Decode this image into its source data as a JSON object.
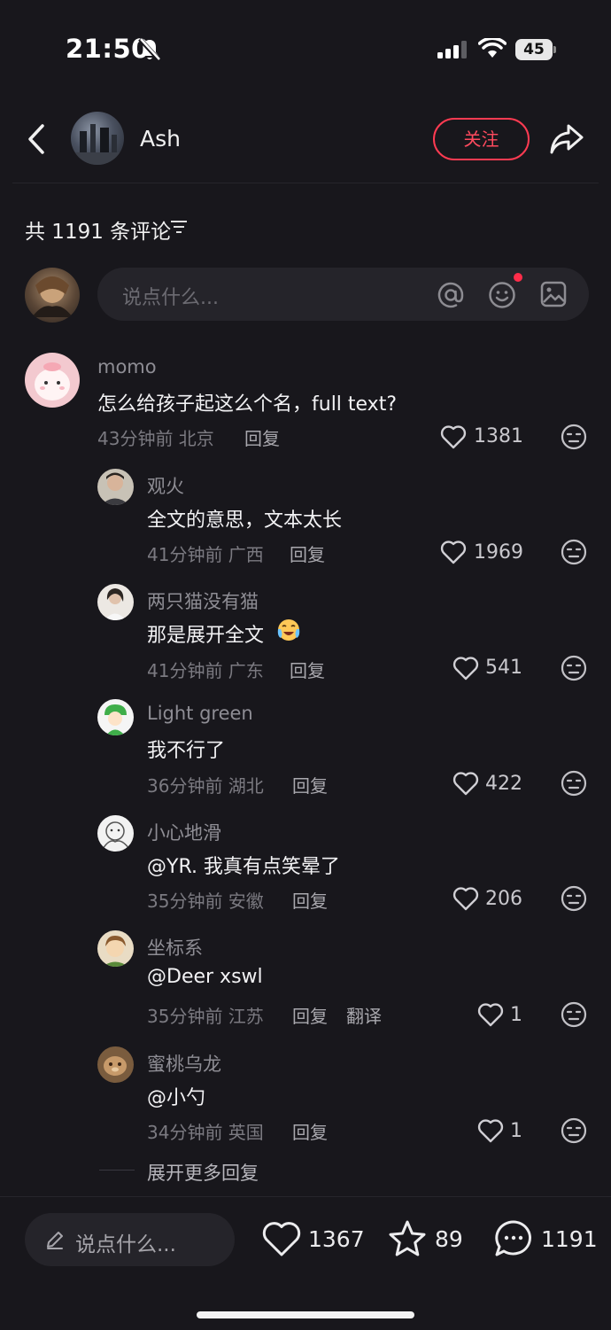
{
  "status_bar": {
    "time": "21:50",
    "battery": "45"
  },
  "header": {
    "author": "Ash",
    "follow_label": "关注"
  },
  "comments_header": {
    "count_label": "共 1191 条评论"
  },
  "input": {
    "placeholder": "说点什么..."
  },
  "comments": [
    {
      "name": "momo",
      "text": "怎么给孩子起这么个名，full text?",
      "time_loc": "43分钟前 北京",
      "reply": "回复",
      "likes": "1381"
    },
    {
      "name": "观火",
      "text": "全文的意思，文本太长",
      "time_loc": "41分钟前 广西",
      "reply": "回复",
      "likes": "1969"
    },
    {
      "name": "两只猫没有猫",
      "text": "那是展开全文",
      "time_loc": "41分钟前 广东",
      "reply": "回复",
      "likes": "541"
    },
    {
      "name": "Light green",
      "text": "我不行了",
      "time_loc": "36分钟前 湖北",
      "reply": "回复",
      "likes": "422"
    },
    {
      "name": "小心地滑",
      "text": "@YR. 我真有点笑晕了",
      "time_loc": "35分钟前 安徽",
      "reply": "回复",
      "likes": "206"
    },
    {
      "name": "坐标系",
      "text": "@Deer xswl",
      "time_loc": "35分钟前 江苏",
      "reply": "回复",
      "translate": "翻译",
      "likes": "1"
    },
    {
      "name": "蜜桃乌龙",
      "text": "@小勺",
      "time_loc": "34分钟前 英国",
      "reply": "回复",
      "likes": "1"
    }
  ],
  "expand_more": "展开更多回复",
  "bottom_bar": {
    "placeholder": "说点什么...",
    "likes": "1367",
    "stars": "89",
    "comments": "1191"
  },
  "colors": {
    "background": "#18171c",
    "accent": "#ff3b52",
    "notify_dot": "#ff2d4a"
  }
}
